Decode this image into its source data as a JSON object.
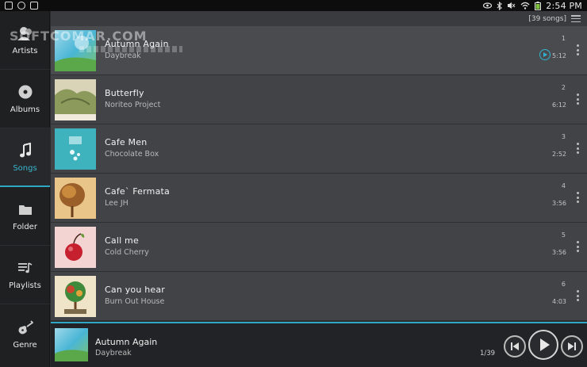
{
  "status_bar": {
    "time": "2:54 PM",
    "icons": [
      "notification-icon",
      "sync-icon",
      "store-icon",
      "eye-icon",
      "bluetooth-icon",
      "mute-icon",
      "wifi-icon",
      "battery-icon"
    ]
  },
  "watermark": "SOFTCOMAR.COM",
  "sidebar": {
    "items": [
      {
        "label": "Artists",
        "icon": "artist-icon"
      },
      {
        "label": "Albums",
        "icon": "disc-icon"
      },
      {
        "label": "Songs",
        "icon": "music-note-icon",
        "active": true
      },
      {
        "label": "Folder",
        "icon": "folder-icon"
      },
      {
        "label": "Playlists",
        "icon": "playlist-icon"
      },
      {
        "label": "Genre",
        "icon": "guitar-icon"
      }
    ]
  },
  "header": {
    "song_count": "[39 songs]"
  },
  "songs": [
    {
      "number": "1",
      "title": "Autumn Again",
      "artist": "Daybreak",
      "duration": "5:12",
      "playing": true
    },
    {
      "number": "2",
      "title": "Butterfly",
      "artist": "Noriteo Project",
      "duration": "6:12"
    },
    {
      "number": "3",
      "title": "Cafe Men",
      "artist": "Chocolate Box",
      "duration": "2:52"
    },
    {
      "number": "4",
      "title": "Cafe` Fermata",
      "artist": "Lee JH",
      "duration": "3:56"
    },
    {
      "number": "5",
      "title": "Call me",
      "artist": "Cold Cherry",
      "duration": "3:56"
    },
    {
      "number": "6",
      "title": "Can you hear",
      "artist": "Burn Out House",
      "duration": "4:03"
    }
  ],
  "now_playing": {
    "title": "Autumn Again",
    "artist": "Daybreak",
    "counter": "1/39"
  },
  "colors": {
    "accent": "#2ea8c2",
    "row_bg": "#424347",
    "sidebar_bg": "#1f2022"
  }
}
